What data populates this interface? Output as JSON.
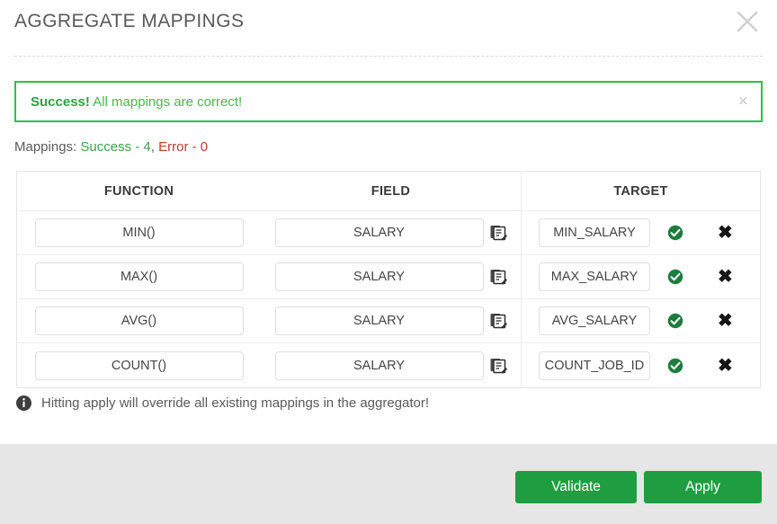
{
  "modal": {
    "title": "AGGREGATE MAPPINGS",
    "close_icon": "close-icon"
  },
  "banner": {
    "strong": "Success!",
    "message": "All mappings are correct!",
    "dismiss": "×",
    "border_color": "#29c441"
  },
  "summary": {
    "label": "Mappings:",
    "success_text": "Success - 4",
    "separator": ",",
    "error_text": "Error - 0",
    "success_color": "#3fa04b",
    "error_color": "#c0392b"
  },
  "table": {
    "headers": {
      "function": "FUNCTION",
      "field": "FIELD",
      "target": "TARGET"
    },
    "rows": [
      {
        "function": "MIN()",
        "field": "SALARY",
        "target": "MIN_SALARY",
        "status": "valid",
        "edit_icon": "edit-document-icon",
        "status_icon": "check-circle-icon",
        "delete_icon": "delete-x-icon",
        "delete": "✖"
      },
      {
        "function": "MAX()",
        "field": "SALARY",
        "target": "MAX_SALARY",
        "status": "valid",
        "edit_icon": "edit-document-icon",
        "status_icon": "check-circle-icon",
        "delete_icon": "delete-x-icon",
        "delete": "✖"
      },
      {
        "function": "AVG()",
        "field": "SALARY",
        "target": "AVG_SALARY",
        "status": "valid",
        "edit_icon": "edit-document-icon",
        "status_icon": "check-circle-icon",
        "delete_icon": "delete-x-icon",
        "delete": "✖"
      },
      {
        "function": "COUNT()",
        "field": "SALARY",
        "target": "COUNT_JOB_ID",
        "status": "valid",
        "edit_icon": "edit-document-icon",
        "status_icon": "check-circle-icon",
        "delete_icon": "delete-x-icon",
        "delete": "✖"
      }
    ]
  },
  "note": {
    "icon": "info-circle-icon",
    "text": "Hitting apply will override all existing mappings in the aggregator!"
  },
  "footer": {
    "validate_label": "Validate",
    "apply_label": "Apply",
    "button_color": "#1f9e41"
  }
}
